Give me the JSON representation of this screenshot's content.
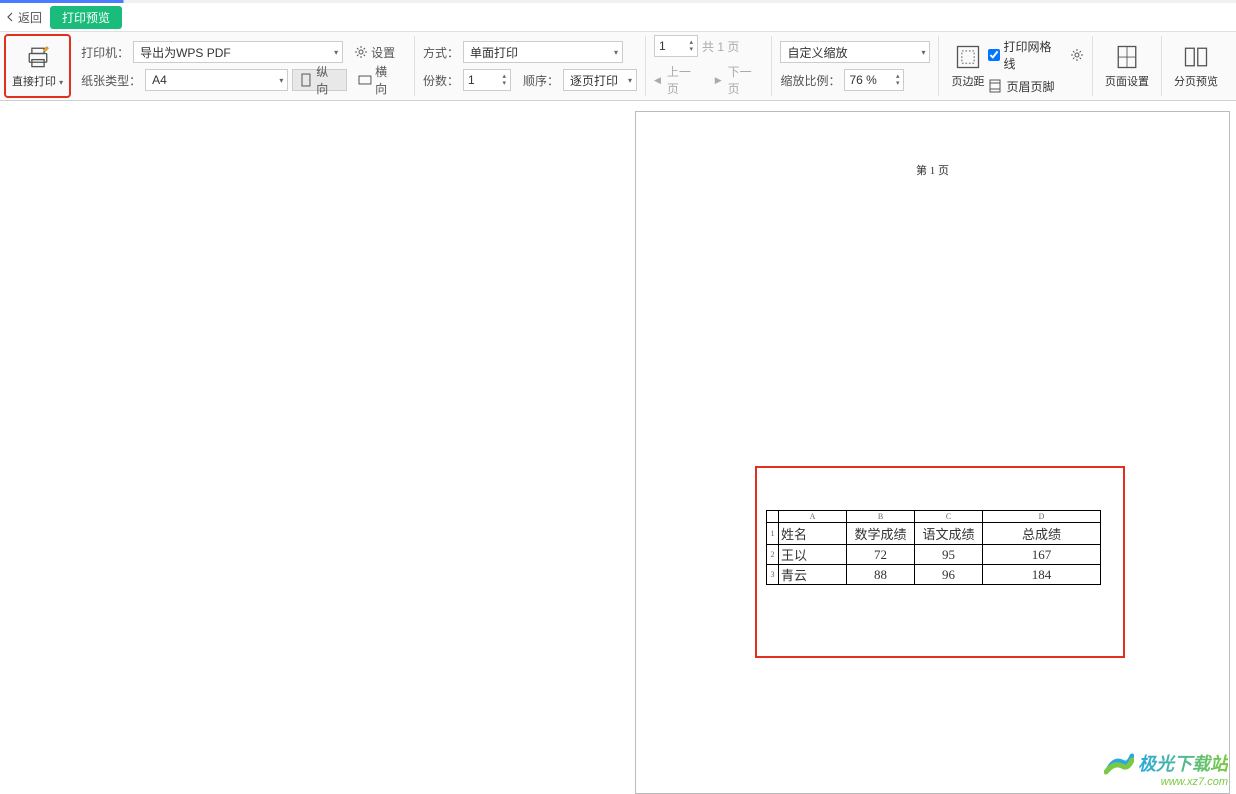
{
  "header": {
    "back_label": "返回",
    "tab_label": "打印预览"
  },
  "toolbar": {
    "direct_print": "直接打印",
    "printer_label": "打印机：",
    "printer_value": "导出为WPS PDF",
    "paper_label": "纸张类型：",
    "paper_value": "A4",
    "settings_label": "设置",
    "portrait_label": "纵向",
    "landscape_label": "横向",
    "mode_label": "方式：",
    "mode_value": "单面打印",
    "copies_label": "份数：",
    "copies_value": "1",
    "order_label": "顺序：",
    "order_value": "逐页打印",
    "page_input": "1",
    "total_pages": "共 1 页",
    "prev_page": "上一页",
    "next_page": "下一页",
    "scale_mode": "自定义缩放",
    "scale_label": "缩放比例：",
    "scale_value": "76 %",
    "margins_label": "页边距",
    "grid_label": "打印网格线",
    "header_footer_label": "页眉页脚",
    "page_setup_label": "页面设置",
    "page_break_label": "分页预览"
  },
  "preview": {
    "page_indicator": "第 1 页",
    "table": {
      "col_letters": [
        "A",
        "B",
        "C",
        "D"
      ],
      "row_nums": [
        "1",
        "2",
        "3"
      ],
      "headers": [
        "姓名",
        "数学成绩",
        "语文成绩",
        "总成绩"
      ],
      "rows": [
        [
          "王以",
          "72",
          "95",
          "167"
        ],
        [
          "青云",
          "88",
          "96",
          "184"
        ]
      ]
    }
  },
  "watermark": {
    "brand": "极光下载站",
    "url": "www.xz7.com"
  }
}
